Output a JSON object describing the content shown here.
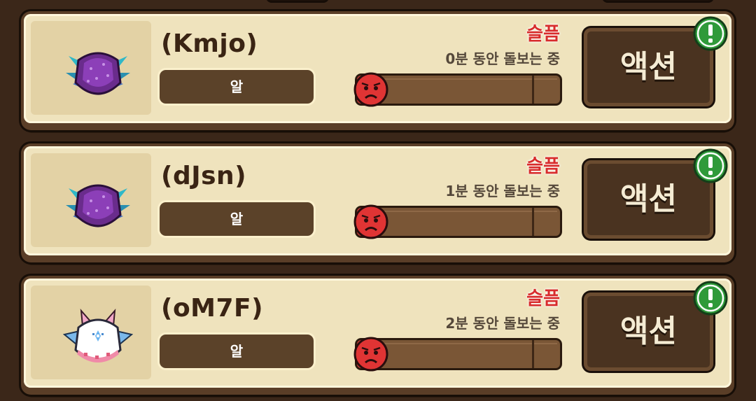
{
  "pets": [
    {
      "name": "(Kmjo)",
      "stage": "알",
      "mood": "슬픔",
      "care_status": "0분 동안 돌보는 중",
      "care_progress": 0.05,
      "action_label": "액션",
      "sprite": "purple-spiked-egg-creature",
      "alert_icon": "exclamation-alert-icon"
    },
    {
      "name": "(dJsn)",
      "stage": "알",
      "mood": "슬픔",
      "care_status": "1분 동안 돌보는 중",
      "care_progress": 0.05,
      "action_label": "액션",
      "sprite": "purple-spiked-egg-creature",
      "alert_icon": "exclamation-alert-icon"
    },
    {
      "name": "(oM7F)",
      "stage": "알",
      "mood": "슬픔",
      "care_status": "2분 동안 돌보는 중",
      "care_progress": 0.05,
      "action_label": "액션",
      "sprite": "white-winged-egg-creature",
      "alert_icon": "exclamation-alert-icon"
    }
  ],
  "colors": {
    "mood_sad": "#d82c2c",
    "alert_green": "#2f9a3a",
    "card_bg": "#efe3bd",
    "page_bg": "#3b2719"
  }
}
